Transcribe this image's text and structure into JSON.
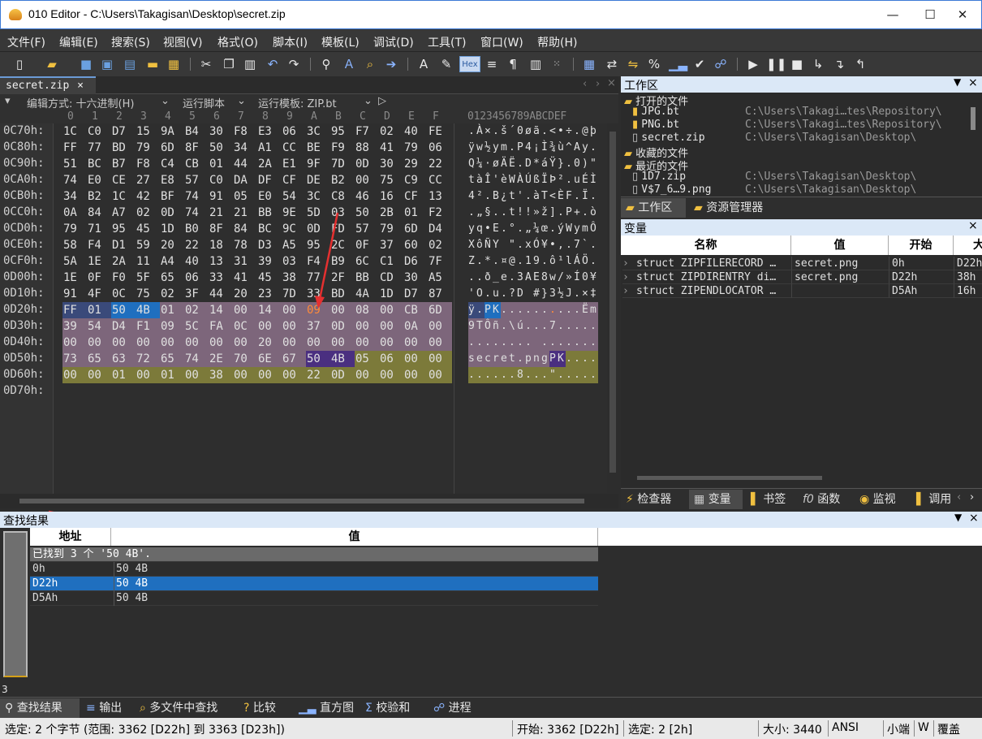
{
  "window": {
    "title": "010 Editor - C:\\Users\\Takagisan\\Desktop\\secret.zip",
    "minimize": "—",
    "maximize": "☐",
    "close": "✕"
  },
  "menu": [
    "文件(F)",
    "编辑(E)",
    "搜索(S)",
    "视图(V)",
    "格式(O)",
    "脚本(I)",
    "模板(L)",
    "调试(D)",
    "工具(T)",
    "窗口(W)",
    "帮助(H)"
  ],
  "file_tab": {
    "label": "secret.zip",
    "close": "×"
  },
  "editor_options": {
    "edit_as": "编辑方式: 十六进制(H)",
    "run_script": "运行脚本",
    "run_template": "运行模板: ZIP.bt"
  },
  "hex_header": [
    "0",
    "1",
    "2",
    "3",
    "4",
    "5",
    "6",
    "7",
    "8",
    "9",
    "A",
    "B",
    "C",
    "D",
    "E",
    "F"
  ],
  "ascii_header": "0123456789ABCDEF",
  "hex_rows": [
    {
      "addr": "0C70h:",
      "bytes": "1C C0 D7 15 9A B4 30 F8 E3 06 3C 95 F7 02 40 FE",
      "ascii": ".À×.š´0øã.<•÷.@þ"
    },
    {
      "addr": "0C80h:",
      "bytes": "FF 77 BD 79 6D 8F 50 34 A1 CC BE F9 88 41 79 06",
      "ascii": "ÿw½ym.P4¡Ì¾ù^Ay."
    },
    {
      "addr": "0C90h:",
      "bytes": "51 BC B7 F8 C4 CB 01 44 2A E1 9F 7D 0D 30 29 22",
      "ascii": "Q¼·øÄË.D*áŸ}.0)\""
    },
    {
      "addr": "0CA0h:",
      "bytes": "74 E0 CE 27 E8 57 C0 DA DF CF DE B2 00 75 C9 CC",
      "ascii": "tàÎ'èWÀÚßÏÞ².uÉÌ"
    },
    {
      "addr": "0CB0h:",
      "bytes": "34 B2 1C 42 BF 74 91 05 E0 54 3C C8 46 16 CF 13",
      "ascii": "4².B¿t'.àT<ÈF.Ï."
    },
    {
      "addr": "0CC0h:",
      "bytes": "0A 84 A7 02 0D 74 21 21 BB 9E 5D 03 50 2B 01 F2",
      "ascii": ".„§..t!!»ž].P+.ò"
    },
    {
      "addr": "0CD0h:",
      "bytes": "79 71 95 45 1D B0 8F 84 BC 9C 0D FD 57 79 6D D4",
      "ascii": "yq•E.°.„¼œ.ýWymÔ"
    },
    {
      "addr": "0CE0h:",
      "bytes": "58 F4 D1 59 20 22 18 78 D3 A5 95 2C 0F 37 60 02",
      "ascii": "XôÑY \".xÓ¥•,.7`."
    },
    {
      "addr": "0CF0h:",
      "bytes": "5A 1E 2A 11 A4 40 13 31 39 03 F4 B9 6C C1 D6 7F",
      "ascii": "Z.*.¤@.19.ô¹lÁÖ."
    },
    {
      "addr": "0D00h:",
      "bytes": "1E 0F F0 5F 65 06 33 41 45 38 77 2F BB CD 30 A5",
      "ascii": "..ð_e.3AE8w/»Í0¥"
    },
    {
      "addr": "0D10h:",
      "bytes": "91 4F 0C 75 02 3F 44 20 23 7D 33 BD 4A 1D D7 87",
      "ascii": "'O.u.?D #}3½J.×‡"
    },
    {
      "addr": "0D20h:",
      "bytes": "FF 01 50 4B 01 02 14 00 14 00 09 00 08 00 CB 6D",
      "ascii": "ÿ.PK..........Ëm"
    },
    {
      "addr": "0D30h:",
      "bytes": "39 54 D4 F1 09 5C FA 0C 00 00 37 0D 00 00 0A 00",
      "ascii": "9TÔñ.\\ú...7....."
    },
    {
      "addr": "0D40h:",
      "bytes": "00 00 00 00 00 00 00 00 20 00 00 00 00 00 00 00",
      "ascii": "........ ......."
    },
    {
      "addr": "0D50h:",
      "bytes": "73 65 63 72 65 74 2E 70 6E 67 50 4B 05 06 00 00",
      "ascii": "secret.pngPK...."
    },
    {
      "addr": "0D60h:",
      "bytes": "00 00 01 00 01 00 38 00 00 00 22 0D 00 00 00 00",
      "ascii": "......8...\"....."
    },
    {
      "addr": "0D70h:",
      "bytes": "",
      "ascii": ""
    }
  ],
  "workspace": {
    "title": "工作区",
    "close": "×",
    "items": [
      {
        "label": "打开的文件",
        "path": ""
      },
      {
        "label": "JPG.bt",
        "path": "C:\\Users\\Takagi…tes\\Repository\\"
      },
      {
        "label": "PNG.bt",
        "path": "C:\\Users\\Takagi…tes\\Repository\\"
      },
      {
        "label": "secret.zip",
        "path": "C:\\Users\\Takagisan\\Desktop\\"
      },
      {
        "label": "收藏的文件",
        "path": ""
      },
      {
        "label": "最近的文件",
        "path": ""
      },
      {
        "label": "1D7.zip",
        "path": "C:\\Users\\Takagisan\\Desktop\\"
      },
      {
        "label": "V$7_6…9.png",
        "path": "C:\\Users\\Takagisan\\Desktop\\"
      }
    ],
    "tabs": [
      "工作区",
      "资源管理器"
    ]
  },
  "variables": {
    "title": "变量",
    "close": "×",
    "columns": [
      "名称",
      "值",
      "开始",
      "大"
    ],
    "rows": [
      {
        "name": "struct ZIPFILERECORD …",
        "value": "secret.png",
        "start": "0h",
        "size": "D22h"
      },
      {
        "name": "struct ZIPDIRENTRY di…",
        "value": "secret.png",
        "start": "D22h",
        "size": "38h"
      },
      {
        "name": "struct ZIPENDLOCATOR …",
        "value": "",
        "start": "D5Ah",
        "size": "16h"
      }
    ],
    "tabs": [
      "检查器",
      "变量",
      "书签",
      "函数",
      "监视",
      "调用"
    ]
  },
  "find_results": {
    "title": "查找结果",
    "close": "×",
    "columns": [
      "地址",
      "值"
    ],
    "summary": "已找到 3 个 '50 4B'.",
    "rows": [
      {
        "addr": "0h",
        "value": "50 4B"
      },
      {
        "addr": "D22h",
        "value": "50 4B"
      },
      {
        "addr": "D5Ah",
        "value": "50 4B"
      }
    ],
    "side_count": "3"
  },
  "bottom_tabs": [
    "查找结果",
    "输出",
    "多文件中查找",
    "比较",
    "直方图",
    "校验和",
    "进程"
  ],
  "status": {
    "selection": "选定: 2 个字节 (范围: 3362 [D22h] 到 3363 [D23h])",
    "start": "开始: 3362 [D22h]",
    "selected": "选定: 2 [2h]",
    "size": "大小: 3440",
    "encoding": "ANSI",
    "endian": "小端",
    "w": "W",
    "mode": "覆盖"
  },
  "colors": {
    "accent": "#1f6fbf",
    "highlight_orange": "#e8702a",
    "struct_purple": "#7d667b",
    "struct_olive": "#7c7a3a"
  }
}
